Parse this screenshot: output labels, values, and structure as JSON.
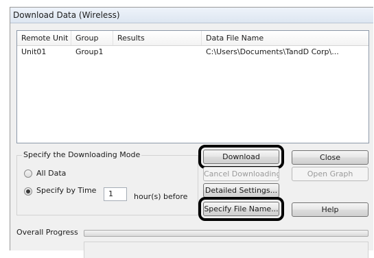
{
  "window": {
    "title": "Download Data (Wireless)"
  },
  "list": {
    "columns": [
      "Remote Unit",
      "Group",
      "Results",
      "Data File Name"
    ],
    "rows": [
      [
        "Unit01",
        "Group1",
        "",
        "C:\\Users\\Documents\\TandD Corp\\..."
      ]
    ]
  },
  "mode": {
    "group_label": "Specify the Downloading Mode",
    "all_data_label": "All Data",
    "by_time_label": "Specify by Time",
    "selected": "Specify by Time",
    "hours_value": "1",
    "hours_suffix": "hour(s) before"
  },
  "buttons": {
    "download": "Download",
    "cancel_downloading": "Cancel Downloading",
    "detailed_settings": "Detailed Settings...",
    "specify_file_name": "Specify File Name...",
    "close": "Close",
    "open_graph": "Open Graph",
    "help": "Help"
  },
  "progress": {
    "label": "Overall Progress",
    "value": 0
  }
}
